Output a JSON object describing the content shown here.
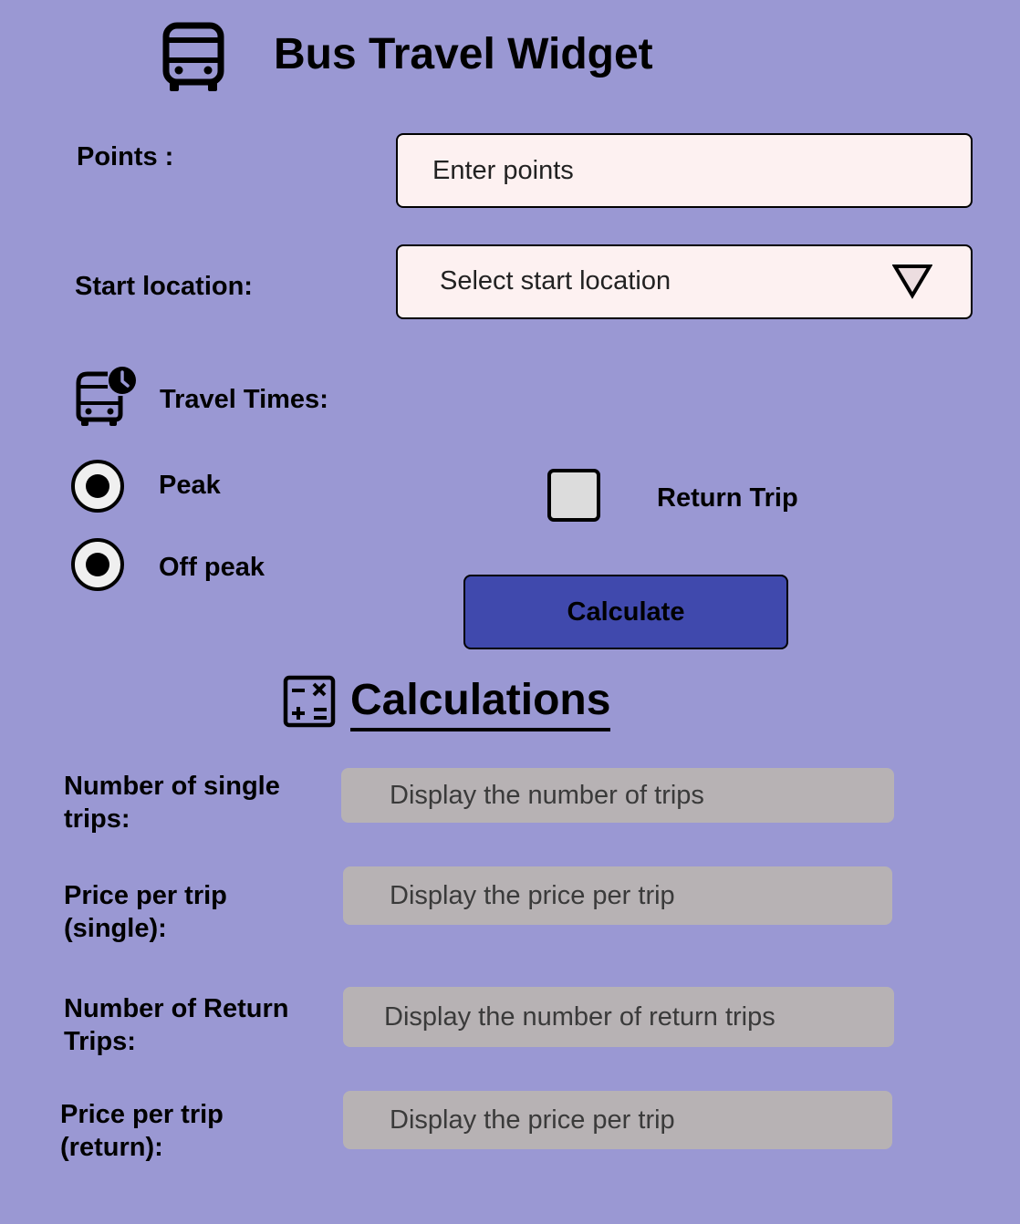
{
  "header": {
    "title": "Bus Travel Widget",
    "icon": "bus-icon"
  },
  "form": {
    "points": {
      "label": "Points :",
      "placeholder": "Enter points"
    },
    "start_location": {
      "label": "Start location:",
      "placeholder": "Select start location",
      "icon": "triangle-down-icon"
    },
    "travel_times": {
      "label": "Travel Times:",
      "icon": "bus-clock-icon",
      "options": [
        {
          "label": "Peak",
          "selected": true
        },
        {
          "label": "Off peak",
          "selected": true
        }
      ]
    },
    "return_trip": {
      "label": "Return Trip",
      "checked": false
    },
    "calculate_button": {
      "label": "Calculate"
    }
  },
  "calculations": {
    "title": "Calculations",
    "icon": "calculator-icon",
    "rows": [
      {
        "label": "Number of single\ntrips:",
        "placeholder": "Display the number of trips"
      },
      {
        "label": "Price per trip\n(single):",
        "placeholder": "Display the price per trip"
      },
      {
        "label": "Number of Return\nTrips:",
        "placeholder": "Display the number of return trips"
      },
      {
        "label": "Price per trip\n(return):",
        "placeholder": "Display the price per trip"
      }
    ]
  },
  "colors": {
    "background": "#9a98d3",
    "input_background": "#fdf1f1",
    "button_background": "#4049ad",
    "output_background": "#b7b2b4",
    "radio_background": "#efefef",
    "checkbox_background": "#dcdcdc"
  }
}
